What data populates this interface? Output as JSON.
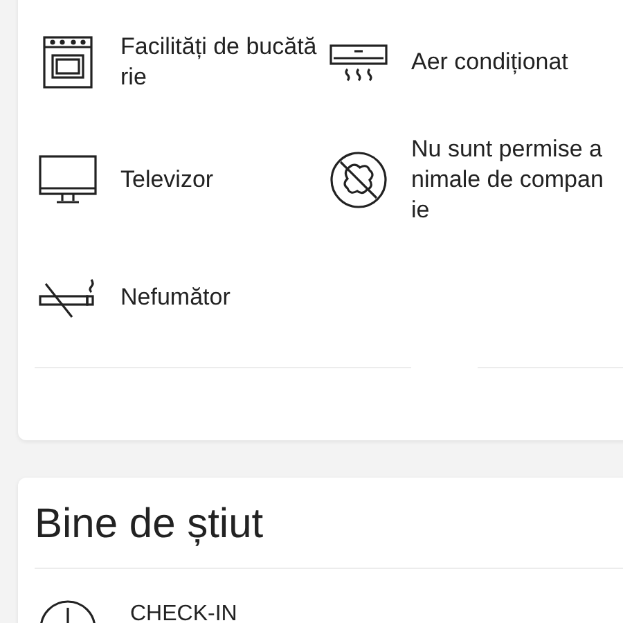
{
  "amenities": [
    {
      "kind": "oven",
      "label": "Facilități de bucătărie"
    },
    {
      "kind": "air-conditioner",
      "label": "Aer condiționat"
    },
    {
      "kind": "tv",
      "label": "Televizor"
    },
    {
      "kind": "no-pets",
      "label": "Nu sunt permise animale de companie"
    },
    {
      "kind": "no-smoking",
      "label": "Nefumător"
    }
  ],
  "good_to_know": {
    "title": "Bine de știut",
    "items": [
      {
        "kind": "clock",
        "label": "CHECK-IN"
      }
    ]
  }
}
